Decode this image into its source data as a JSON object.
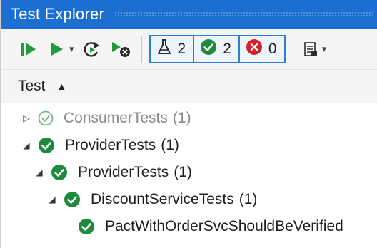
{
  "window": {
    "title": "Test Explorer"
  },
  "toolbar": {
    "run_all_icon": "run-all-icon",
    "run_icon": "run-icon",
    "run_dropdown_caret": "▾",
    "repeat_icon": "repeat-last-run-icon",
    "cancel_icon": "cancel-run-icon",
    "playlist_caret": "▾",
    "counters": {
      "total": {
        "icon": "flask-icon",
        "value": "2"
      },
      "passed": {
        "icon": "passed-icon",
        "value": "2"
      },
      "failed": {
        "icon": "failed-icon",
        "value": "0"
      }
    }
  },
  "grid": {
    "column_header": "Test",
    "sort_glyph": "▲"
  },
  "tree": {
    "rows": [
      {
        "label": "ConsumerTests",
        "count": "(1)",
        "expander": "▷",
        "status": "passed-outline"
      },
      {
        "label": "ProviderTests",
        "count": "(1)",
        "expander": "◢",
        "status": "passed"
      },
      {
        "label": "ProviderTests",
        "count": "(1)",
        "expander": "◢",
        "status": "passed"
      },
      {
        "label": "DiscountServiceTests",
        "count": "(1)",
        "expander": "◢",
        "status": "passed"
      },
      {
        "label": "PactWithOrderSvcShouldBeVerified",
        "count": "",
        "expander": "",
        "status": "passed"
      }
    ]
  },
  "colors": {
    "title_bar": "#1c6fd0",
    "passed": "#1e8a3c",
    "failed": "#d6202a",
    "run_green": "#1f9b3b",
    "selection_border": "#2f7fd0"
  }
}
